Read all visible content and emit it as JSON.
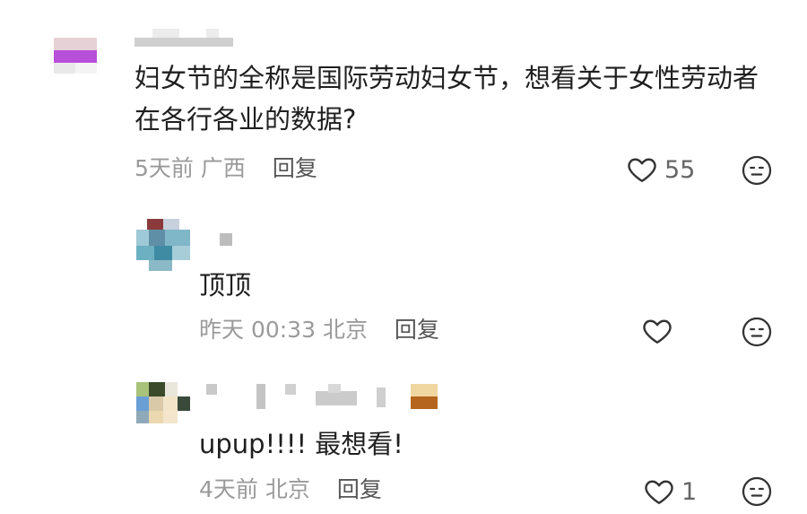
{
  "comments": [
    {
      "text": "妇女节的全称是国际劳动妇女节，想看关于女性劳动者在各行各业的数据?",
      "time": "5天前",
      "location": "广西",
      "reply_label": "回复",
      "likes": "55",
      "replies": [
        {
          "text": "顶顶",
          "time": "昨天 00:33",
          "location": "北京",
          "reply_label": "回复",
          "likes": ""
        },
        {
          "text": "upup!!!! 最想看!",
          "time": "4天前",
          "location": "北京",
          "reply_label": "回复",
          "likes": "1"
        }
      ]
    }
  ],
  "icons": {
    "like": "heart-outline-icon",
    "emoji": "neutral-face-icon"
  },
  "colors": {
    "text": "#1f1f1f",
    "meta": "#9a9a9a",
    "icon": "#333333"
  }
}
